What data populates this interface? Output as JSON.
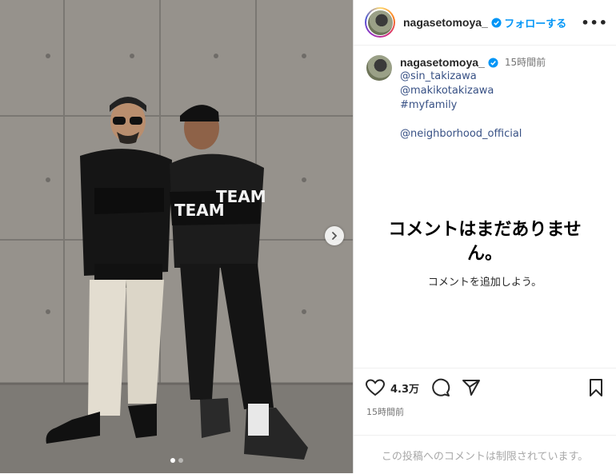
{
  "post": {
    "username": "nagasetomoya_",
    "follow_label": "フォローする",
    "more_label": "•••",
    "caption": {
      "username": "nagasetomoya_",
      "time_ago": "15時間前",
      "lines": [
        "@sin_takizawa",
        "@makikotakizawa",
        "#myfamily",
        "@neighborhood_official"
      ]
    },
    "empty_comments": {
      "title": "コメントはまだありません。",
      "subtitle": "コメントを追加しよう。"
    },
    "likes": "4.3万",
    "timestamp": "15時間前",
    "comment_restricted": "この投稿へのコメントは制限されています。"
  },
  "media": {
    "carousel_count": 2,
    "carousel_active": 1,
    "jacket_text": [
      "TEAM",
      "TEAM"
    ]
  },
  "colors": {
    "accent": "#0095f6",
    "link": "#385185",
    "muted": "#737373"
  },
  "icons": [
    "verified-icon",
    "more-icon",
    "heart-icon",
    "comment-icon",
    "share-icon",
    "bookmark-icon",
    "chevron-right-icon"
  ]
}
